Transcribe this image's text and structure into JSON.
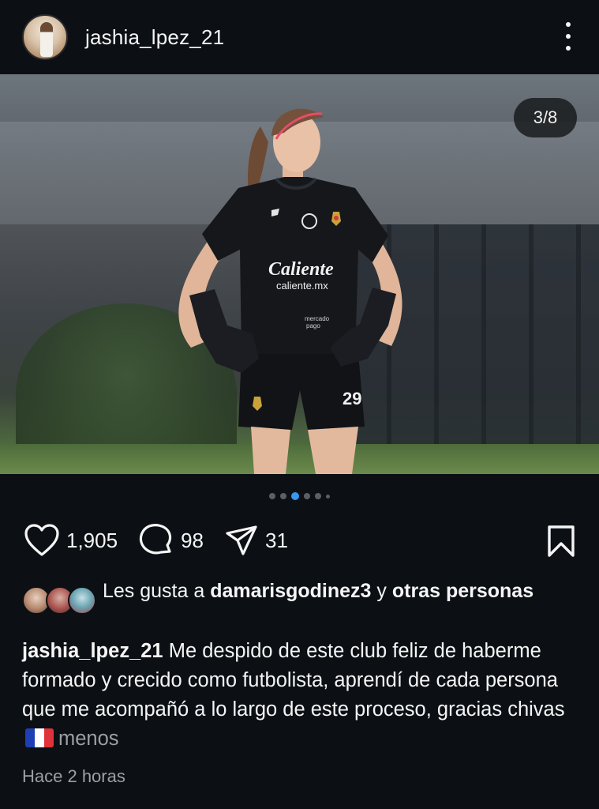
{
  "post": {
    "username": "jashia_lpez_21",
    "slide_counter": "3/8",
    "slide_index": 3,
    "slide_total": 8
  },
  "actions": {
    "likes_count": "1,905",
    "comments_count": "98",
    "shares_count": "31"
  },
  "liked_by": {
    "prefix": "Les gusta a",
    "user": "damarisgodinez3",
    "joiner": "y",
    "others": "otras personas"
  },
  "caption": {
    "user": "jashia_lpez_21",
    "text": "Me despido de este club feliz de haberme formado y crecido como futbolista, aprendí de cada persona que me acompañó a lo largo de este proceso, gracias chivas",
    "flag": "french-flag",
    "less_label": "menos"
  },
  "timestamp": "Hace 2 horas",
  "photo": {
    "jersey_sponsor": "Caliente",
    "jersey_sponsor_url": "caliente.mx",
    "jersey_sponsor_2a": "mercado",
    "jersey_sponsor_2b": "pago",
    "jersey_number": "29"
  },
  "colors": {
    "background": "#0c1014",
    "text": "#f5f5f5",
    "secondary_text": "#9aa0a6",
    "accent_dot": "#3897f0"
  }
}
